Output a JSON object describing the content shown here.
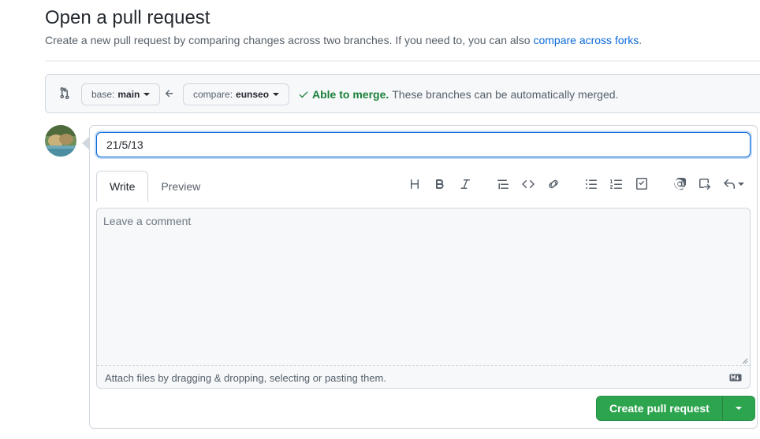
{
  "header": {
    "title": "Open a pull request",
    "subtitle": "Create a new pull request by comparing changes across two branches. If you need to, you can also",
    "subtitle_link": "compare across forks",
    "subtitle_end": "."
  },
  "range": {
    "base_prefix": "base:",
    "base_branch": "main",
    "compare_prefix": "compare:",
    "compare_branch": "eunseo",
    "merge_ok": "Able to merge.",
    "merge_detail": "These branches can be automatically merged."
  },
  "compose": {
    "title_value": "21/5/13",
    "tabs": [
      {
        "label": "Write"
      },
      {
        "label": "Preview"
      }
    ],
    "body_placeholder": "Leave a comment",
    "dropzone_text": "Attach files by dragging & dropping, selecting or pasting them.",
    "create_label": "Create pull request"
  },
  "toolbar": {
    "icons": [
      "heading-icon",
      "bold-icon",
      "italic-icon",
      "quote-icon",
      "code-icon",
      "link-icon",
      "unordered-list-icon",
      "ordered-list-icon",
      "task-list-icon",
      "mention-icon",
      "cross-reference-icon",
      "reply-icon"
    ]
  },
  "colors": {
    "accent": "#0969da",
    "success": "#1a7f37",
    "primary_button": "#2da44e",
    "border": "#d0d7de",
    "canvas_subtle": "#f6f8fa"
  }
}
